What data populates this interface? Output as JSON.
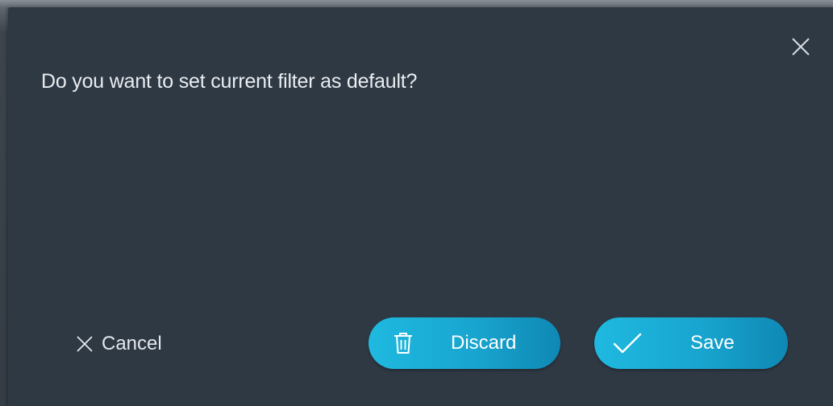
{
  "dialog": {
    "message": "Do you want to set current filter as default?",
    "close_icon": "close-icon",
    "cancel": {
      "label": "Cancel",
      "icon": "close-icon"
    },
    "discard": {
      "label": "Discard",
      "icon": "trash-icon"
    },
    "save": {
      "label": "Save",
      "icon": "checkmark-icon"
    }
  },
  "colors": {
    "dialog_background": "#2f3944",
    "text": "#e9edf1",
    "accent_start": "#1fb9e0",
    "accent_end": "#0f88b4"
  }
}
